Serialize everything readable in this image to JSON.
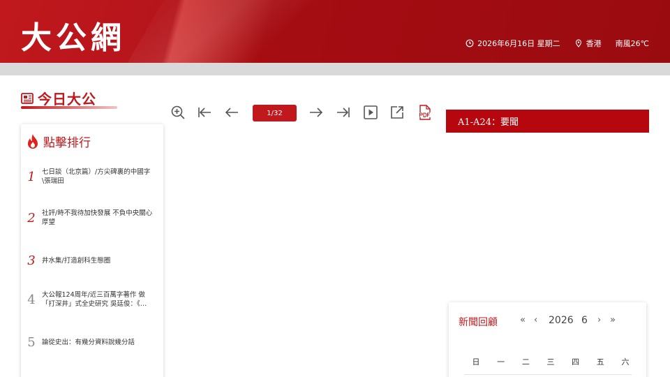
{
  "header": {
    "logo": "大公網",
    "date": "2026年6月16日 星期二",
    "location": "香港",
    "weather": "南風26℃"
  },
  "today": {
    "title": "今日大公"
  },
  "ranking": {
    "title": "點擊排行",
    "items": [
      {
        "num": "1",
        "text": "七日談（北京篇）/方尖碑裏的中國字\\張瑞田"
      },
      {
        "num": "2",
        "text": "社評/時不我待加快發展 不負中央關心厚望"
      },
      {
        "num": "3",
        "text": "井水集/打造創科生態圈"
      },
      {
        "num": "4",
        "text": "大公報124周年/近三百萬字著作 做「打深井」式全史研究 吳廷俊：《…"
      },
      {
        "num": "5",
        "text": "論從史出：有幾分資料說幾分話"
      }
    ]
  },
  "toolbar": {
    "page": "1/32",
    "icons": [
      "zoom-in-icon",
      "first-page-icon",
      "prev-page-icon",
      "next-page-icon",
      "last-page-icon",
      "play-icon",
      "open-external-icon",
      "pdf-icon"
    ]
  },
  "section": {
    "label": "A1-A24：要聞"
  },
  "calendar": {
    "title": "新聞回顧",
    "prev_year": "«",
    "prev_month": "‹",
    "year": "2026",
    "month": "6",
    "next_month": "›",
    "next_year": "»",
    "weekdays": [
      "日",
      "一",
      "二",
      "三",
      "四",
      "五",
      "六"
    ]
  },
  "colors": {
    "brand": "#c0181d",
    "section_bar": "#b5070d",
    "strip": "#d9d9d9"
  }
}
